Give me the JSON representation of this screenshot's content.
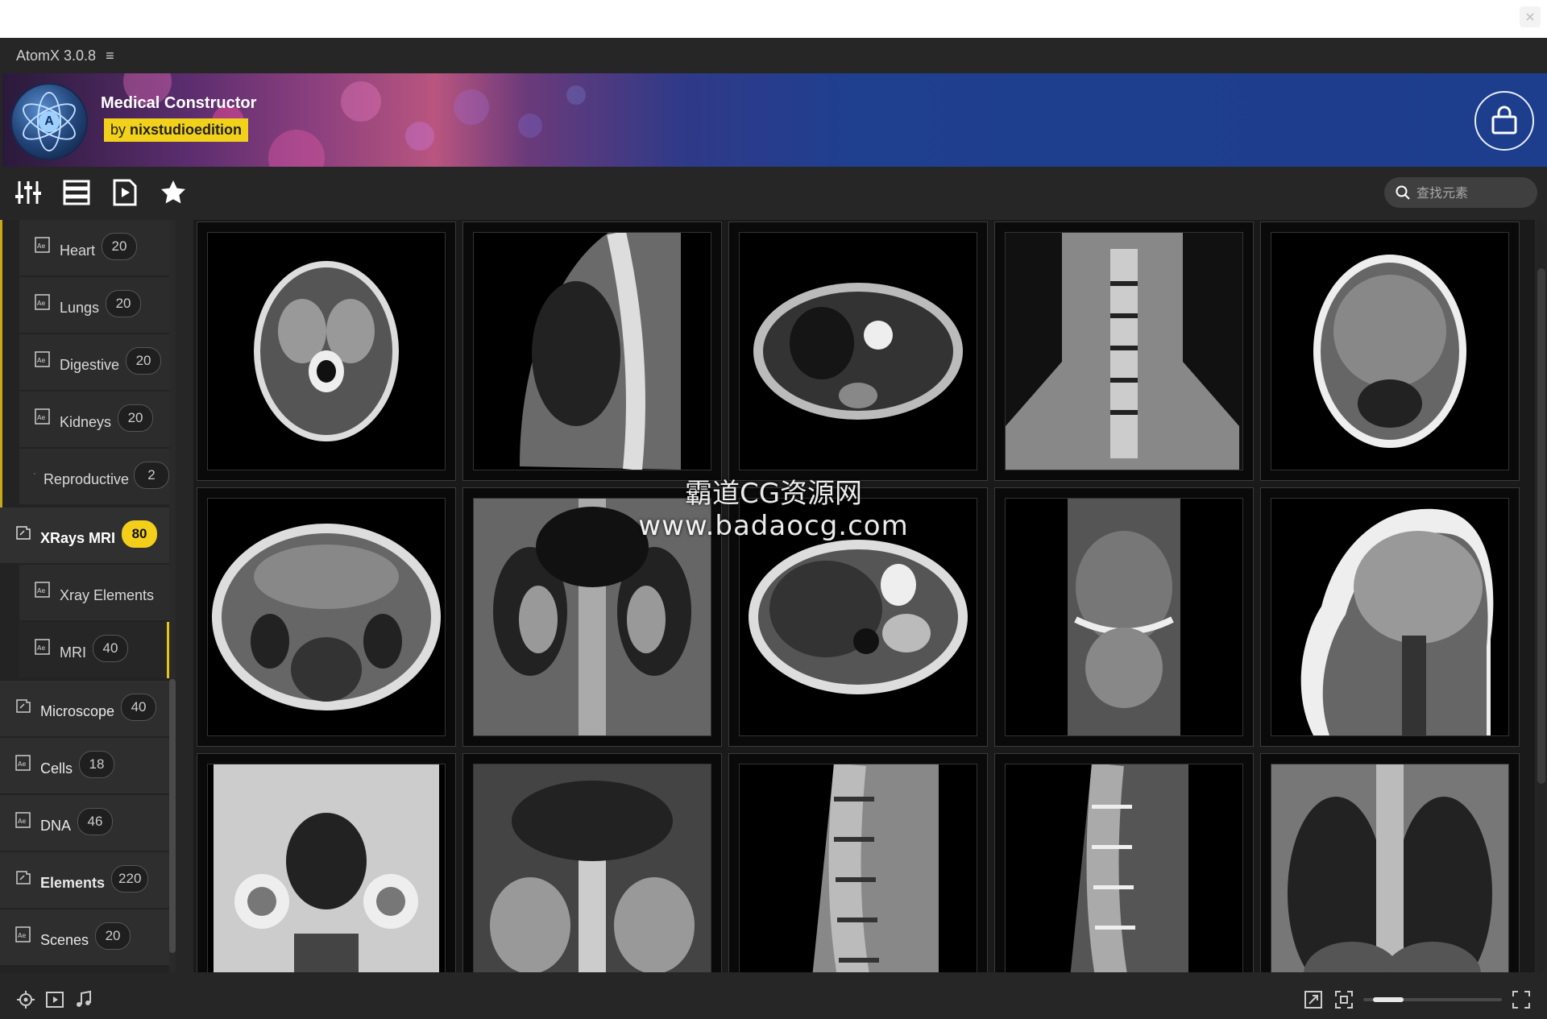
{
  "app": {
    "title": "AtomX 3.0.8",
    "menu_icon": "hamburger-icon"
  },
  "banner": {
    "product_title": "Medical Constructor",
    "by_prefix": "by",
    "by_author": "nixstudioedition",
    "logo_letter": "A",
    "logo_icon": "atom-logo-icon",
    "cart_icon": "shopping-bag-icon",
    "colors": {
      "banner_blue": "#1d3e8c",
      "badge_yellow": "#f2d11b"
    }
  },
  "toolbar": {
    "tools": [
      "sliders-icon",
      "list-view-icon",
      "play-document-icon",
      "favorites-star-icon"
    ],
    "search_placeholder": "查找元素",
    "search_icon": "search-icon"
  },
  "sidebar": {
    "items": [
      {
        "label": "Heart",
        "count": "20",
        "kind": "child"
      },
      {
        "label": "Lungs",
        "count": "20",
        "kind": "child"
      },
      {
        "label": "Digestive",
        "count": "20",
        "kind": "child"
      },
      {
        "label": "Kidneys",
        "count": "20",
        "kind": "child"
      },
      {
        "label": "Reproductive",
        "count": "2",
        "kind": "child"
      },
      {
        "label": "XRays MRI",
        "count": "80",
        "kind": "parent-active"
      },
      {
        "label": "Xray Elements",
        "count": "",
        "kind": "child"
      },
      {
        "label": "MRI",
        "count": "40",
        "kind": "child-selected"
      },
      {
        "label": "Microscope",
        "count": "40",
        "kind": "parent"
      },
      {
        "label": "Cells",
        "count": "18",
        "kind": "parent"
      },
      {
        "label": "DNA",
        "count": "46",
        "kind": "parent"
      },
      {
        "label": "Elements",
        "count": "220",
        "kind": "parent"
      },
      {
        "label": "Scenes",
        "count": "20",
        "kind": "parent"
      }
    ],
    "item_icon": "ae-file-icon",
    "accent": "#f3cf1c"
  },
  "grid": {
    "thumbnails": [
      "axial brain MRI",
      "sagittal spine MRI",
      "axial abdomen MRI",
      "coronal neck MRI",
      "axial head MRI",
      "axial abdomen kidneys MRI",
      "coronal abdomen kidneys MRI",
      "axial liver MRI",
      "coronal knee MRI",
      "sagittal head MRI",
      "coronal pelvis hips MRI",
      "coronal abdomen MRI",
      "sagittal lumbar spine MRI",
      "sagittal lumbar spine MRI",
      "coronal chest MRI"
    ]
  },
  "watermark": {
    "line1": "霸道CG资源网",
    "line2": "www.badaocg.com"
  },
  "bottombar": {
    "left_icons": [
      "target-icon",
      "play-square-icon",
      "music-note-icon"
    ],
    "right_icons": [
      "resize-icon",
      "fit-screen-icon",
      "fullscreen-icon"
    ],
    "zoom_slider_value": 0.25
  }
}
